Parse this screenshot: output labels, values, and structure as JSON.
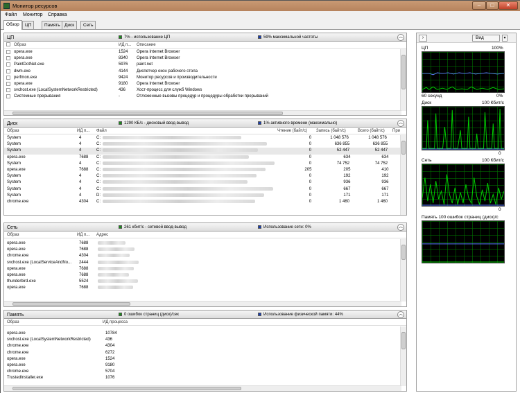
{
  "window": {
    "title": "Монитор ресурсов"
  },
  "menu": [
    "Файл",
    "Монитор",
    "Справка"
  ],
  "tabs": [
    "Обзор",
    "ЦП",
    "Память",
    "Диск",
    "Сеть"
  ],
  "colors": {
    "green": "#1a8f1a",
    "blue": "#1a3fb0",
    "graph_green": "#00d000",
    "graph_blue": "#5a7aff"
  },
  "cpu": {
    "title": "ЦП",
    "legend1": "7% - использование ЦП",
    "legend2": "59% максимальной частоты",
    "headers": [
      "Образ",
      "ИД п...",
      "Описание"
    ],
    "rows": [
      {
        "image": "opera.exe",
        "pid": "1524",
        "desc": "Opera Internet Browser"
      },
      {
        "image": "opera.exe",
        "pid": "8340",
        "desc": "Opera Internet Browser"
      },
      {
        "image": "PaintDotNet.exe",
        "pid": "5976",
        "desc": "paint.net"
      },
      {
        "image": "dwm.exe",
        "pid": "4144",
        "desc": "Диспетчер окон рабочего стола"
      },
      {
        "image": "perfmon.exe",
        "pid": "9424",
        "desc": "Монитор ресурсов и производительности"
      },
      {
        "image": "opera.exe",
        "pid": "9180",
        "desc": "Opera Internet Browser"
      },
      {
        "image": "svchost.exe (LocalSystemNetworkRestricted)",
        "pid": "436",
        "desc": "Хост-процесс для служб Windows"
      },
      {
        "image": "Системные прерывания",
        "pid": "-",
        "desc": "Отложенные вызовы процедур и процедуры обработки прерываний"
      }
    ]
  },
  "disk": {
    "title": "Диск",
    "legend1": "1290 КБ/с - дисковый ввод-вывод",
    "legend2": "1% активного времени (максимально)",
    "headers": [
      "Образ",
      "ИД п...",
      "Файл",
      "Чтение (байт/с)",
      "Запись (байт/с)",
      "Всего (байт/с)",
      "При"
    ],
    "rows": [
      {
        "image": "System",
        "pid": "4",
        "file": "C:",
        "read": "0",
        "write": "1 048 576",
        "total": "1 048 576"
      },
      {
        "image": "System",
        "pid": "4",
        "file": "C:",
        "read": "0",
        "write": "636 855",
        "total": "636 855"
      },
      {
        "image": "System",
        "pid": "4",
        "file": "C:",
        "read": "0",
        "write": "52 447",
        "total": "52 447"
      },
      {
        "image": "opera.exe",
        "pid": "7688",
        "file": "C:",
        "read": "0",
        "write": "634",
        "total": "634"
      },
      {
        "image": "System",
        "pid": "4",
        "file": "C:",
        "read": "0",
        "write": "74 752",
        "total": "74 752"
      },
      {
        "image": "opera.exe",
        "pid": "7688",
        "file": "C:",
        "read": "205",
        "write": "205",
        "total": "410"
      },
      {
        "image": "System",
        "pid": "4",
        "file": "C:",
        "read": "0",
        "write": "192",
        "total": "192"
      },
      {
        "image": "System",
        "pid": "4",
        "file": "C:",
        "read": "0",
        "write": "936",
        "total": "936"
      },
      {
        "image": "System",
        "pid": "4",
        "file": "C:",
        "read": "0",
        "write": "667",
        "total": "667"
      },
      {
        "image": "System",
        "pid": "4",
        "file": "D:",
        "read": "0",
        "write": "171",
        "total": "171"
      },
      {
        "image": "chrome.exe",
        "pid": "4304",
        "file": "C:",
        "read": "0",
        "write": "1 460",
        "total": "1 460"
      }
    ]
  },
  "network": {
    "title": "Сеть",
    "legend1": "261 кбит/с - сетевой ввод-вывод",
    "legend2": "Использование сети: 0%",
    "headers": [
      "Образ",
      "ИД п...",
      "Адрес"
    ],
    "rows": [
      {
        "image": "opera.exe",
        "pid": "7688"
      },
      {
        "image": "opera.exe",
        "pid": "7688"
      },
      {
        "image": "chrome.exe",
        "pid": "4304"
      },
      {
        "image": "svchost.exe (LocalServiceAndNo...",
        "pid": "2444"
      },
      {
        "image": "opera.exe",
        "pid": "7688"
      },
      {
        "image": "opera.exe",
        "pid": "7688"
      },
      {
        "image": "thunderbird.exe",
        "pid": "5524"
      },
      {
        "image": "opera.exe",
        "pid": "7688"
      }
    ]
  },
  "memory": {
    "title": "Память",
    "legend1": "0 ошибок страниц (диск)/сек",
    "legend2": "Использование физической памяти: 44%",
    "headers": [
      "Образ",
      "ИД процесса"
    ],
    "rows": [
      {
        "image": "opera.exe",
        "pid": "10784"
      },
      {
        "image": "svchost.exe (LocalSystemNetworkRestricted)",
        "pid": "436"
      },
      {
        "image": "chrome.exe",
        "pid": "4304"
      },
      {
        "image": "chrome.exe",
        "pid": "6272"
      },
      {
        "image": "opera.exe",
        "pid": "1524"
      },
      {
        "image": "opera.exe",
        "pid": "9180"
      },
      {
        "image": "chrome.exe",
        "pid": "5704"
      },
      {
        "image": "TrustedInstaller.exe",
        "pid": "1076"
      }
    ]
  },
  "side": {
    "view_label": "Вид",
    "graphs": [
      {
        "name": "ЦП",
        "top": "100%",
        "bottom_left": "60 секунд",
        "bottom_right": "0%"
      },
      {
        "name": "Диск",
        "top": "100 Кбит/с",
        "bottom_right": "0"
      },
      {
        "name": "Сеть",
        "top": "100 Кбит/с",
        "bottom_right": "0"
      },
      {
        "name": "Память 100 ошибок страниц (диск)/с"
      }
    ]
  }
}
